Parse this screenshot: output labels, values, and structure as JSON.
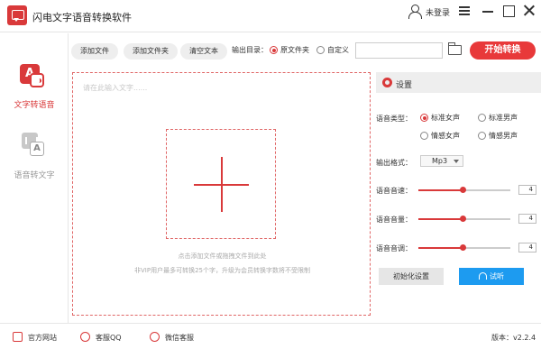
{
  "app": {
    "title": "闪电文字语音转换软件"
  },
  "window": {
    "user_label": "未登录"
  },
  "sidebar": {
    "items": [
      {
        "label": "文字转语音",
        "icon": "text-to-speech-icon",
        "active": true
      },
      {
        "label": "语音转文字",
        "icon": "speech-to-text-icon",
        "active": false
      }
    ]
  },
  "toolbar": {
    "add_file": "添加文件",
    "add_folder": "添加文件夹",
    "clear_text": "清空文本",
    "output_label": "输出目录：",
    "output_options": [
      "原文件夹",
      "自定义"
    ],
    "output_selected": "原文件夹",
    "output_path": "",
    "start_button": "开始转换"
  },
  "editor": {
    "placeholder": "请在此输入文字......",
    "hint_line1": "点击添加文件或拖拽文件到此处",
    "hint_line2": "非VIP用户最多可转换25个字，升级为会员转换字数将不受限制"
  },
  "settings": {
    "title": "设置",
    "voice_type_label": "语音类型：",
    "voice_options": [
      "标准女声",
      "标准男声",
      "情感女声",
      "情感男声"
    ],
    "voice_selected": "标准女声",
    "format_label": "输出格式：",
    "format_value": "Mp3",
    "speed_label": "语音音速：",
    "speed_value": "4",
    "volume_label": "语音音量：",
    "volume_value": "4",
    "pitch_label": "语音音调：",
    "pitch_value": "4",
    "init_button": "初始化设置",
    "listen_button": "试听"
  },
  "footer": {
    "website": "官方网站",
    "qq": "客服QQ",
    "wechat": "微信客服",
    "version": "版本：v2.2.4"
  },
  "colors": {
    "accent": "#d9393a",
    "listen_blue": "#1d9bf0"
  }
}
